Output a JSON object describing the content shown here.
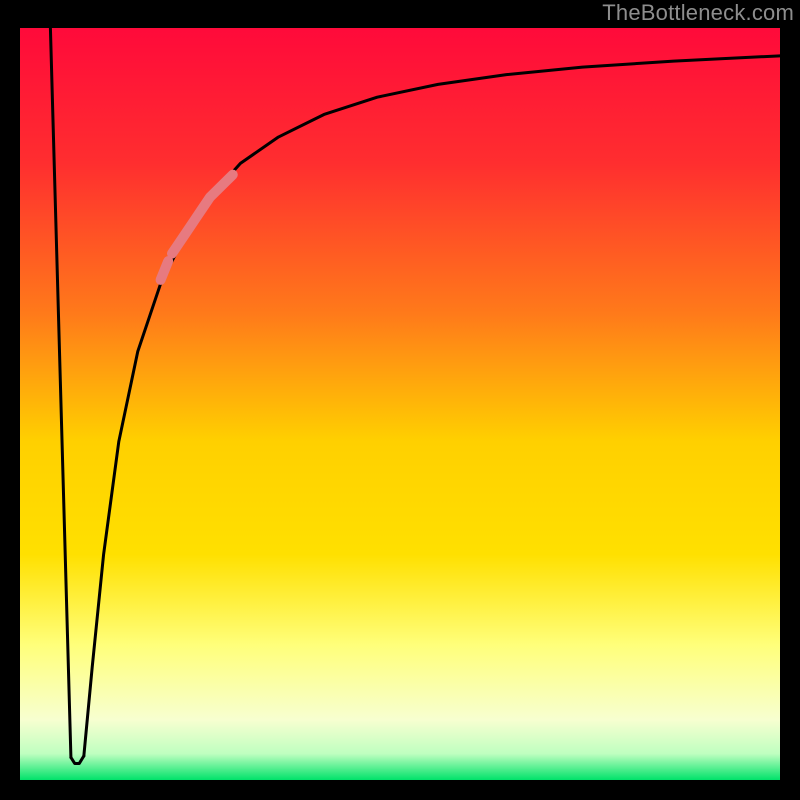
{
  "watermark": "TheBottleneck.com",
  "chart_data": {
    "type": "line",
    "title": "",
    "xlabel": "",
    "ylabel": "",
    "xlim": [
      0,
      100
    ],
    "ylim": [
      0,
      100
    ],
    "grid": false,
    "legend": false,
    "background_gradient": {
      "top": "#ff0a3a",
      "mid_upper": "#ff7a1a",
      "mid": "#ffe000",
      "mid_lower": "#ffff7a",
      "near_bottom": "#f7ffd0",
      "bottom": "#00e26a"
    },
    "series": [
      {
        "name": "left-falling-segment",
        "stroke": "#000000",
        "stroke_width": 3,
        "x": [
          4.0,
          6.7
        ],
        "y": [
          100.0,
          3.0
        ]
      },
      {
        "name": "dip-bottom",
        "stroke": "#000000",
        "stroke_width": 3,
        "x": [
          6.7,
          7.2,
          7.8,
          8.4
        ],
        "y": [
          3.0,
          2.2,
          2.2,
          3.2
        ]
      },
      {
        "name": "rising-curve",
        "stroke": "#000000",
        "stroke_width": 3,
        "x": [
          8.4,
          9.5,
          11.0,
          13.0,
          15.5,
          18.5,
          21.5,
          25.0,
          29.0,
          34.0,
          40.0,
          47.0,
          55.0,
          64.0,
          74.0,
          86.0,
          100.0
        ],
        "y": [
          3.2,
          15.0,
          30.0,
          45.0,
          57.0,
          66.0,
          72.0,
          77.5,
          82.0,
          85.5,
          88.5,
          90.8,
          92.5,
          93.8,
          94.8,
          95.6,
          96.3
        ]
      },
      {
        "name": "pink-highlight-segment",
        "stroke": "#e77a80",
        "stroke_width": 10,
        "x": [
          20.0,
          21.0,
          22.0,
          23.0,
          24.0,
          25.0,
          26.0,
          27.0,
          28.0
        ],
        "y": [
          70.0,
          71.5,
          73.0,
          74.5,
          76.0,
          77.5,
          78.5,
          79.5,
          80.5
        ]
      },
      {
        "name": "pink-dot-lower",
        "stroke": "#e77a80",
        "stroke_width": 10,
        "x": [
          18.5,
          19.5
        ],
        "y": [
          66.5,
          69.0
        ]
      }
    ]
  }
}
